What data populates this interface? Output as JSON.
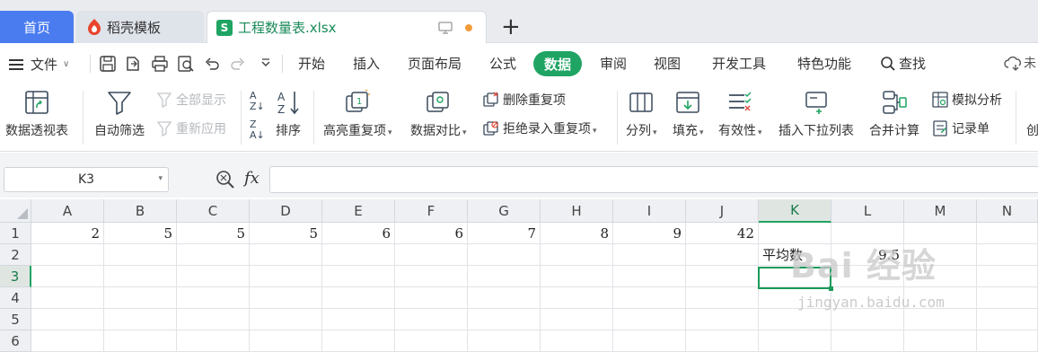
{
  "tabs": {
    "home": "首页",
    "template": "稻壳模板",
    "document": "工程数量表.xlsx"
  },
  "menu": {
    "file": "文件",
    "tabs": [
      "开始",
      "插入",
      "页面布局",
      "公式",
      "数据",
      "审阅",
      "视图",
      "开发工具",
      "特色功能"
    ],
    "active": "数据",
    "search": "查找",
    "cloud": "未"
  },
  "ribbon": {
    "pivot": "数据透视表",
    "autofilter": "自动筛选",
    "show_all": "全部显示",
    "reapply": "重新应用",
    "sort": "排序",
    "highlight_dup": "高亮重复项",
    "compare": "数据对比",
    "remove_dup": "删除重复项",
    "reject_dup": "拒绝录入重复项",
    "split": "分列",
    "fill": "填充",
    "validity": "有效性",
    "insert_dropdown": "插入下拉列表",
    "consolidate": "合并计算",
    "simulation": "模拟分析",
    "record": "记录单",
    "create": "创"
  },
  "formula_bar": {
    "cell_ref": "K3",
    "fx": "fx",
    "content": ""
  },
  "sheet": {
    "columns": [
      "A",
      "B",
      "C",
      "D",
      "E",
      "F",
      "G",
      "H",
      "I",
      "J",
      "K",
      "L",
      "M",
      "N"
    ],
    "rows": [
      "1",
      "2",
      "3",
      "4",
      "5",
      "6"
    ],
    "row1": [
      "2",
      "5",
      "5",
      "5",
      "6",
      "6",
      "7",
      "8",
      "9",
      "42"
    ],
    "k2": "平均数",
    "l2": "9.5",
    "selected_col": "K",
    "selected_row": "3"
  },
  "watermark": {
    "logo": "Bai 经验",
    "url": "jingyan.baidu.com"
  },
  "colors": {
    "accent_green": "#1fa463",
    "home_tab_blue": "#4a7cf0",
    "modified_dot": "#f39c3c"
  }
}
